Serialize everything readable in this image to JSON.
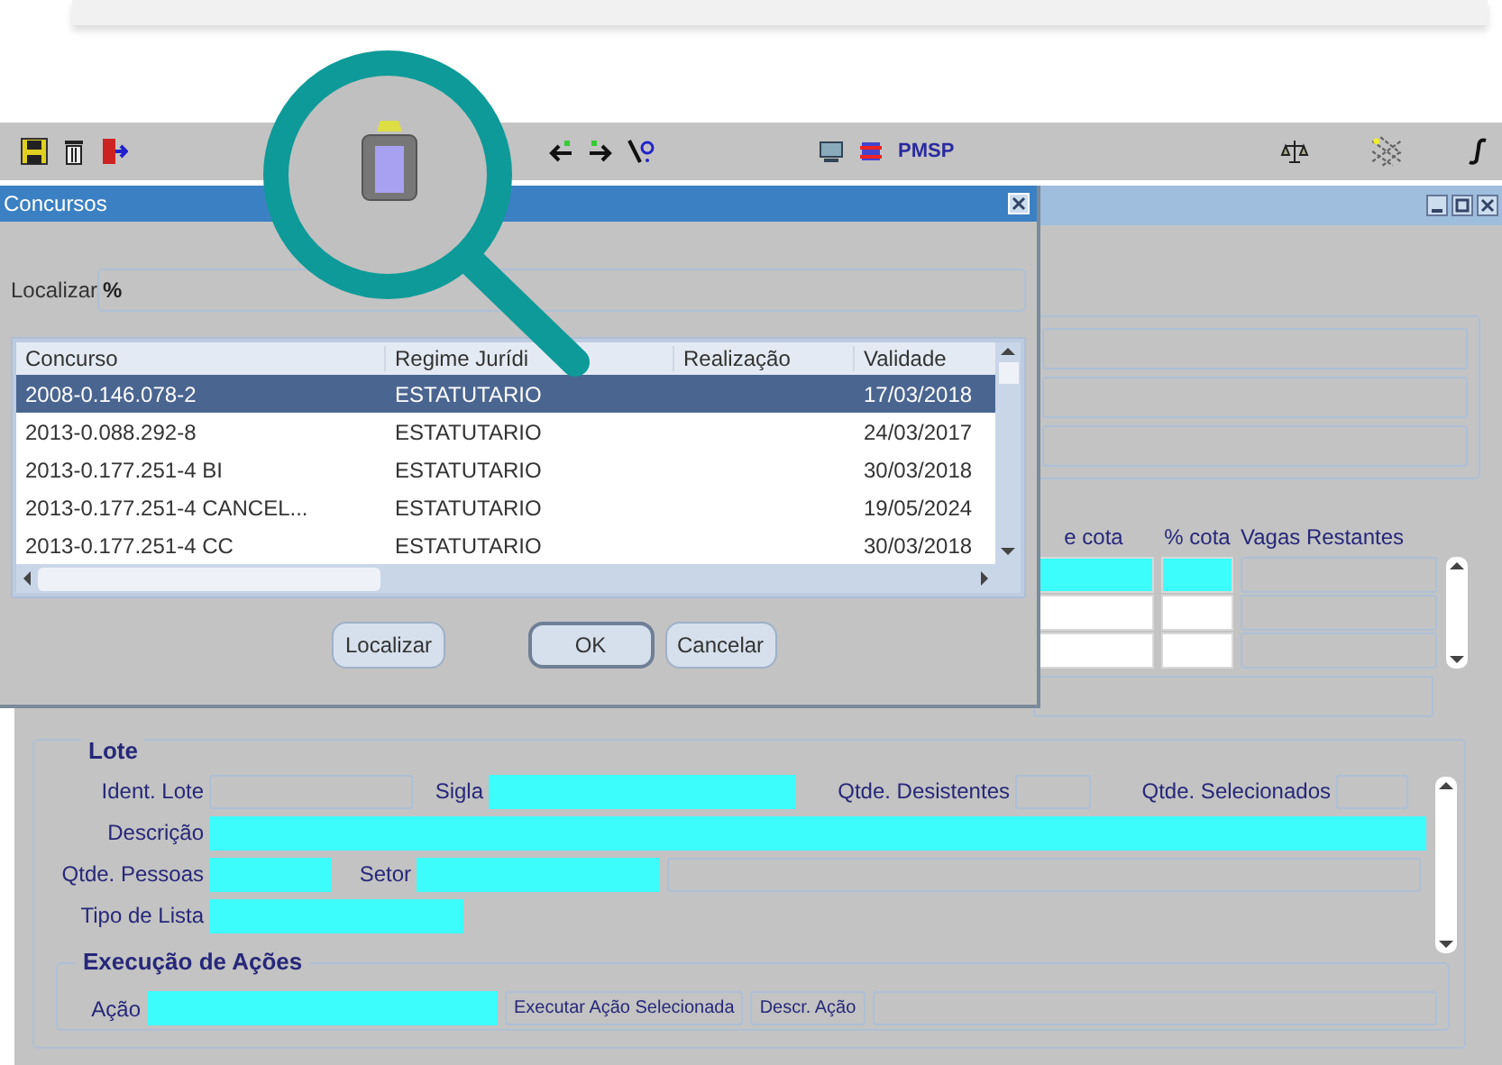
{
  "toolbar": {
    "label": "PMSP"
  },
  "dialog": {
    "title": "Concursos",
    "search": {
      "label": "Localizar",
      "value": "%"
    },
    "columns": [
      "Concurso",
      "Regime Jurídi",
      "Realização",
      "Validade"
    ],
    "rows": [
      {
        "cells": [
          "2008-0.146.078-2",
          "ESTATUTARIO",
          "",
          "17/03/2018"
        ],
        "selected": true
      },
      {
        "cells": [
          "2013-0.088.292-8",
          "ESTATUTARIO",
          "",
          "24/03/2017"
        ],
        "selected": false
      },
      {
        "cells": [
          "2013-0.177.251-4 BI",
          "ESTATUTARIO",
          "",
          "30/03/2018"
        ],
        "selected": false
      },
      {
        "cells": [
          "2013-0.177.251-4 CANCEL...",
          "ESTATUTARIO",
          "",
          "19/05/2024"
        ],
        "selected": false
      },
      {
        "cells": [
          "2013-0.177.251-4 CC",
          "ESTATUTARIO",
          "",
          "30/03/2018"
        ],
        "selected": false
      }
    ],
    "buttons": [
      {
        "label": "Localizar",
        "default": false
      },
      {
        "label": "OK",
        "default": true
      },
      {
        "label": "Cancelar",
        "default": false
      }
    ]
  },
  "quota_table": {
    "columns": [
      "e cota",
      "% cota",
      "Vagas Restantes"
    ],
    "rows": [
      {
        "current": true
      },
      {
        "current": false
      },
      {
        "current": false
      }
    ]
  },
  "lote": {
    "title": "Lote",
    "rows": [
      [
        {
          "label": "Ident. Lote",
          "required": false
        },
        {
          "label": "Sigla",
          "required": true
        },
        {
          "label": "Qtde. Desistentes",
          "required": false
        },
        {
          "label": "Qtde. Selecionados",
          "required": false
        }
      ],
      [
        {
          "label": "Descrição",
          "required": true
        }
      ],
      [
        {
          "label": "Qtde. Pessoas",
          "required": true
        },
        {
          "label": "Setor",
          "required": true
        }
      ],
      [
        {
          "label": "Tipo de Lista",
          "required": true
        }
      ]
    ]
  },
  "acoes": {
    "title": "Execução de Ações",
    "field": {
      "label": "Ação",
      "required": true
    },
    "buttons": [
      "Executar Ação Selecionada",
      "Descr. Ação"
    ]
  }
}
